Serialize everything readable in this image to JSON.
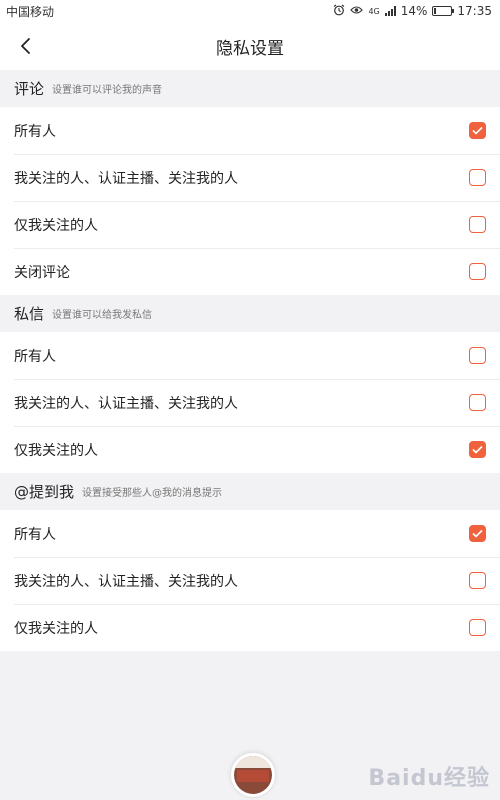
{
  "status_bar": {
    "carrier": "中国移动",
    "network": "4G",
    "battery": "14%",
    "time": "17:35",
    "battery_level": 0.14
  },
  "nav": {
    "title": "隐私设置"
  },
  "sections": [
    {
      "title": "评论",
      "subtitle": "设置谁可以评论我的声音",
      "options": [
        {
          "label": "所有人",
          "checked": true
        },
        {
          "label": "我关注的人、认证主播、关注我的人",
          "checked": false
        },
        {
          "label": "仅我关注的人",
          "checked": false
        },
        {
          "label": "关闭评论",
          "checked": false
        }
      ]
    },
    {
      "title": "私信",
      "subtitle": "设置谁可以给我发私信",
      "options": [
        {
          "label": "所有人",
          "checked": false
        },
        {
          "label": "我关注的人、认证主播、关注我的人",
          "checked": false
        },
        {
          "label": "仅我关注的人",
          "checked": true
        }
      ]
    },
    {
      "title": "@提到我",
      "subtitle": "设置接受那些人@我的消息提示",
      "options": [
        {
          "label": "所有人",
          "checked": true
        },
        {
          "label": "我关注的人、认证主播、关注我的人",
          "checked": false
        },
        {
          "label": "仅我关注的人",
          "checked": false
        }
      ]
    }
  ],
  "watermark": "Baidu经验",
  "colors": {
    "accent": "#f0623d",
    "background": "#f2f2f4"
  },
  "icons": {
    "back": "chevron-left-icon",
    "alarm": "alarm-clock-icon",
    "eye": "eye-icon",
    "check": "checkmark-icon"
  }
}
